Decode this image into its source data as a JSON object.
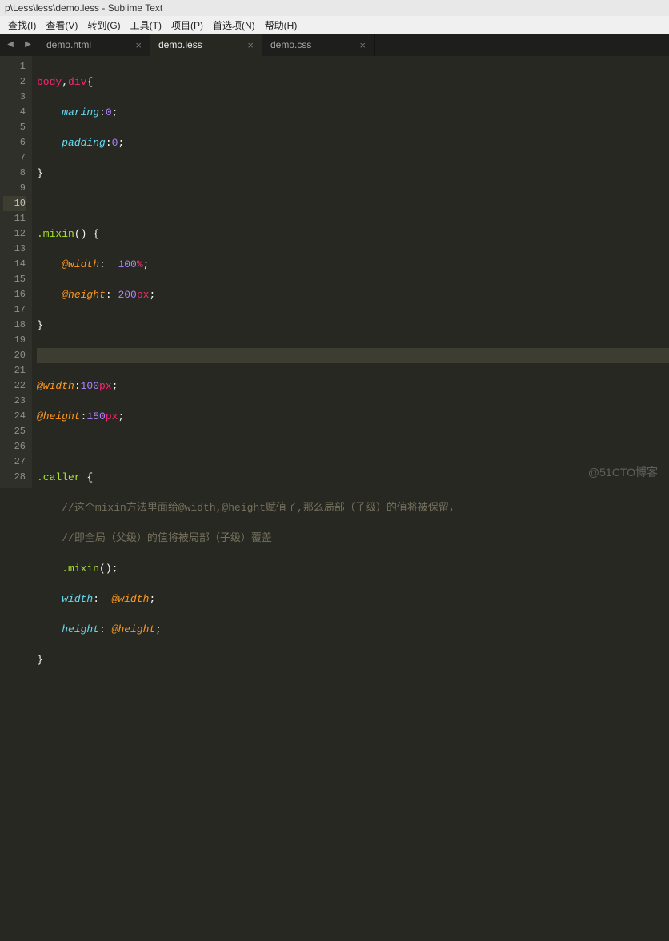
{
  "window": {
    "title": "p\\Less\\less\\demo.less - Sublime Text"
  },
  "menu": {
    "find": "查找(I)",
    "view": "查看(V)",
    "goto": "转到(G)",
    "tools": "工具(T)",
    "project": "项目(P)",
    "preferences": "首选项(N)",
    "help": "帮助(H)"
  },
  "tabs": [
    {
      "label": "demo.html",
      "active": false
    },
    {
      "label": "demo.less",
      "active": true
    },
    {
      "label": "demo.css",
      "active": false
    }
  ],
  "code": {
    "l1a": "body",
    "l1b": ",",
    "l1c": "div",
    "l1d": "{",
    "l2a": "maring",
    "l2b": ":",
    "l2c": "0",
    "l2d": ";",
    "l3a": "padding",
    "l3b": ":",
    "l3c": "0",
    "l3d": ";",
    "l4": "}",
    "l6a": ".mixin",
    "l6b": "() {",
    "l7a": "@width",
    "l7b": ":  ",
    "l7c": "100",
    "l7d": "%",
    "l7e": ";",
    "l8a": "@height",
    "l8b": ": ",
    "l8c": "200",
    "l8d": "px",
    "l8e": ";",
    "l9": "}",
    "l11a": "@width",
    "l11b": ":",
    "l11c": "100",
    "l11d": "px",
    "l11e": ";",
    "l12a": "@height",
    "l12b": ":",
    "l12c": "150",
    "l12d": "px",
    "l12e": ";",
    "l14a": ".caller",
    "l14b": " {",
    "l15": "//这个mixin方法里面给@width,@height赋值了,那么局部（子级）的值将被保留，",
    "l16": "//即全局（父级）的值将被局部（子级）覆盖",
    "l17a": ".mixin",
    "l17b": "();",
    "l18a": "width",
    "l18b": ":  ",
    "l18c": "@width",
    "l18d": ";",
    "l19a": "height",
    "l19b": ": ",
    "l19c": "@height",
    "l19d": ";",
    "l20": "}"
  },
  "highlight_line": 10,
  "watermark": "@51CTO博客"
}
